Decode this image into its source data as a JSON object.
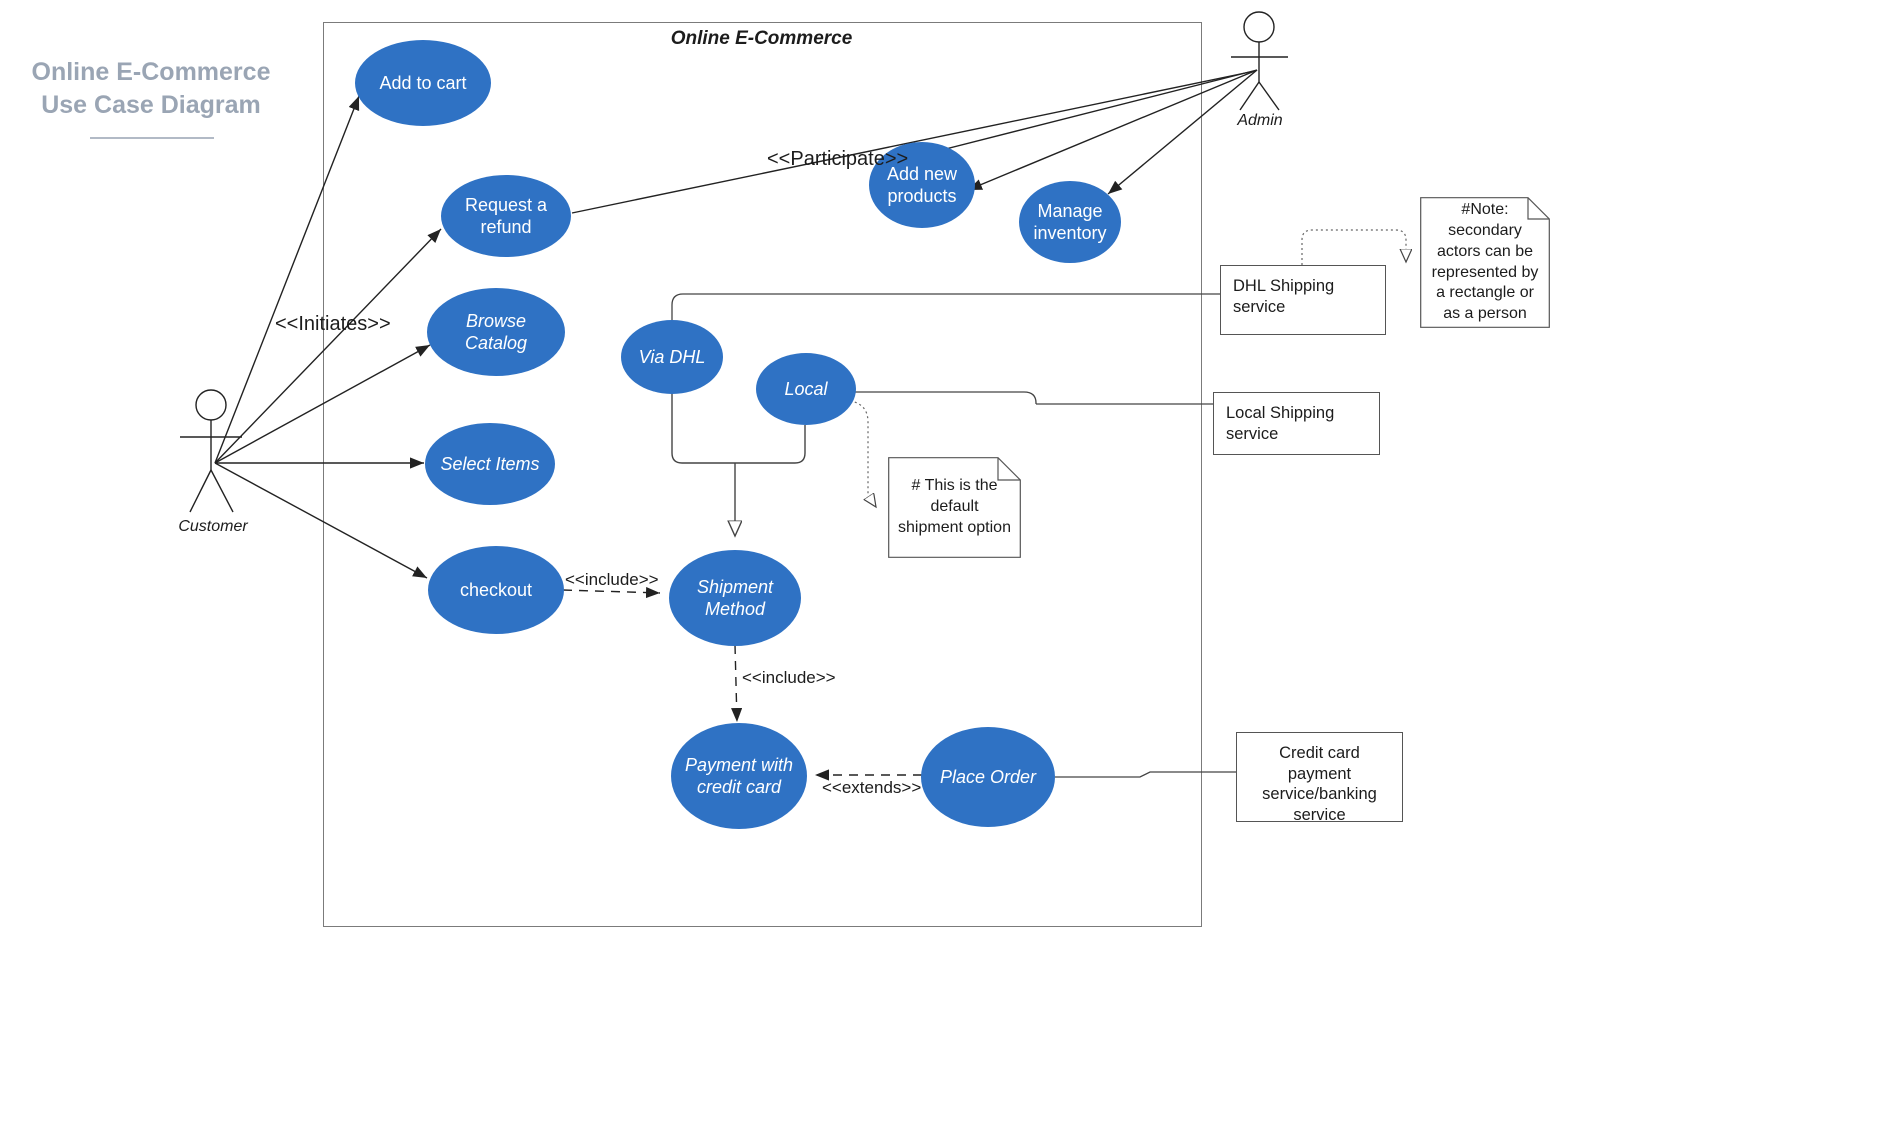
{
  "diagram": {
    "title": "Online E-Commerce Use Case Diagram",
    "boundary_label": "Online E-Commerce",
    "accent_color": "#2f72c4",
    "title_color": "#9aa5b4",
    "line_color": "#333333"
  },
  "actors": [
    {
      "name": "Customer",
      "label": "Customer"
    },
    {
      "name": "Admin",
      "label": "Admin"
    }
  ],
  "use_cases": [
    {
      "id": "add_to_cart",
      "label": "Add to cart"
    },
    {
      "id": "request_refund",
      "label": "Request a refund"
    },
    {
      "id": "browse_catalog",
      "label": "Browse Catalog"
    },
    {
      "id": "select_items",
      "label": "Select Items"
    },
    {
      "id": "checkout",
      "label": "checkout"
    },
    {
      "id": "via_dhl",
      "label": "Via DHL"
    },
    {
      "id": "local",
      "label": "Local"
    },
    {
      "id": "shipment_method",
      "label": "Shipment Method"
    },
    {
      "id": "payment_cc",
      "label": "Payment with credit card"
    },
    {
      "id": "place_order",
      "label": "Place Order"
    },
    {
      "id": "add_new_products",
      "label": "Add new products"
    },
    {
      "id": "manage_inventory",
      "label": "Manage inventory"
    }
  ],
  "external_systems": [
    {
      "id": "dhl_service",
      "label": "DHL Shipping service"
    },
    {
      "id": "local_service",
      "label": "Local Shipping service"
    },
    {
      "id": "cc_service",
      "label": "Credit card payment service/banking service"
    }
  ],
  "notes": [
    {
      "id": "note_secondary_actors",
      "text": "#Note: secondary actors can be represented by a rectangle or as a person"
    },
    {
      "id": "note_default_shipment",
      "text": "# This is the default shipment option"
    }
  ],
  "relationship_labels": {
    "initiates": "<<Initiates>>",
    "participate": "<<Participate>>",
    "include_checkout": "<<include>>",
    "include_payment": "<<include>>",
    "extends": "<<extends>>"
  }
}
